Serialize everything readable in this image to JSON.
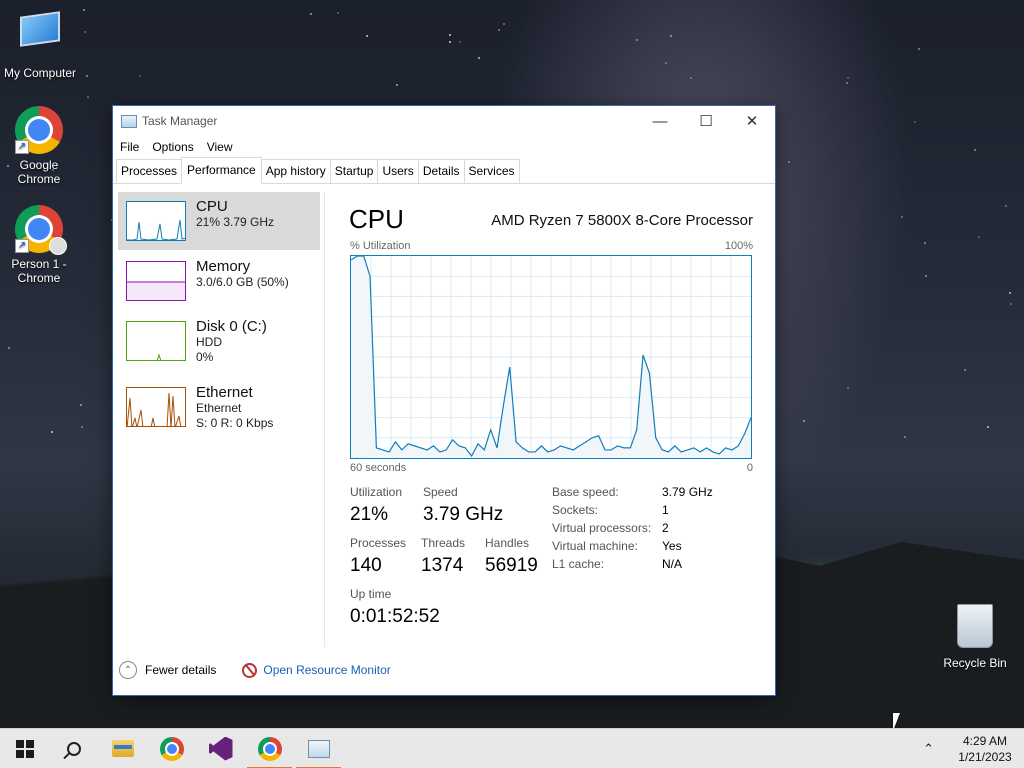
{
  "desktop": {
    "icons": [
      {
        "label": "My Computer",
        "icon": "computer-icon"
      },
      {
        "label": "Google\nChrome",
        "icon": "chrome-icon"
      },
      {
        "label": "Person 1 -\nChrome",
        "icon": "chrome-profile-icon"
      },
      {
        "label": "Recycle Bin",
        "icon": "recycle-bin-icon"
      }
    ]
  },
  "window": {
    "title": "Task Manager",
    "menu": [
      "File",
      "Options",
      "View"
    ],
    "tabs": [
      "Processes",
      "Performance",
      "App history",
      "Startup",
      "Users",
      "Details",
      "Services"
    ],
    "active_tab": "Performance"
  },
  "resources": [
    {
      "name": "CPU",
      "line1": "21% 3.79 GHz",
      "line2": "",
      "color": "#117dbb",
      "selected": true
    },
    {
      "name": "Memory",
      "line1": "3.0/6.0 GB (50%)",
      "line2": "",
      "color": "#8b12ae",
      "selected": false
    },
    {
      "name": "Disk 0 (C:)",
      "line1": "HDD",
      "line2": "0%",
      "color": "#4da60c",
      "selected": false
    },
    {
      "name": "Ethernet",
      "line1": "Ethernet",
      "line2": "S: 0 R: 0 Kbps",
      "color": "#a74f01",
      "selected": false
    }
  ],
  "cpu": {
    "title": "CPU",
    "processor": "AMD Ryzen 7 5800X 8-Core Processor",
    "graph_label_top_left": "% Utilization",
    "graph_label_top_right": "100%",
    "graph_label_bottom_left": "60 seconds",
    "graph_label_bottom_right": "0",
    "utilization_history": [
      98,
      100,
      100,
      90,
      5,
      4,
      3,
      8,
      4,
      7,
      6,
      5,
      4,
      6,
      3,
      4,
      9,
      6,
      5,
      1,
      7,
      4,
      14,
      5,
      26,
      45,
      8,
      5,
      3,
      3,
      6,
      3,
      4,
      6,
      5,
      4,
      6,
      8,
      10,
      11,
      4,
      4,
      6,
      5,
      5,
      14,
      51,
      42,
      10,
      4,
      3,
      6,
      3,
      4,
      5,
      3,
      5,
      3,
      2,
      5,
      4,
      6,
      12,
      20
    ],
    "stats": {
      "utilization_label": "Utilization",
      "utilization": "21%",
      "speed_label": "Speed",
      "speed": "3.79 GHz",
      "processes_label": "Processes",
      "processes": "140",
      "threads_label": "Threads",
      "threads": "1374",
      "handles_label": "Handles",
      "handles": "56919",
      "uptime_label": "Up time",
      "uptime": "0:01:52:52"
    },
    "details": [
      {
        "label": "Base speed:",
        "value": "3.79 GHz"
      },
      {
        "label": "Sockets:",
        "value": "1"
      },
      {
        "label": "Virtual processors:",
        "value": "2"
      },
      {
        "label": "Virtual machine:",
        "value": "Yes"
      },
      {
        "label": "L1 cache:",
        "value": "N/A"
      }
    ]
  },
  "footer": {
    "fewer_details": "Fewer details",
    "resource_monitor": "Open Resource Monitor"
  },
  "taskbar": {
    "items": [
      "start-button",
      "search-button",
      "file-explorer",
      "chrome",
      "visual-studio",
      "chrome",
      "task-manager"
    ],
    "clock_time": "4:29 AM",
    "clock_date": "1/21/2023"
  }
}
